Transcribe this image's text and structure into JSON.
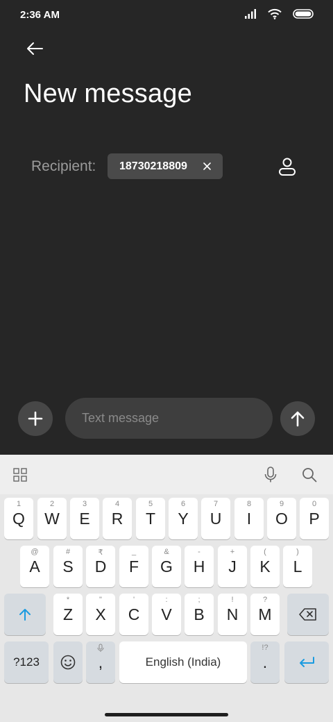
{
  "status": {
    "time": "2:36 AM"
  },
  "header": {
    "title": "New message"
  },
  "recipient": {
    "label": "Recipient:",
    "chip_value": "18730218809"
  },
  "compose": {
    "placeholder": "Text message"
  },
  "keyboard": {
    "row1": [
      {
        "letter": "Q",
        "hint": "1"
      },
      {
        "letter": "W",
        "hint": "2"
      },
      {
        "letter": "E",
        "hint": "3"
      },
      {
        "letter": "R",
        "hint": "4"
      },
      {
        "letter": "T",
        "hint": "5"
      },
      {
        "letter": "Y",
        "hint": "6"
      },
      {
        "letter": "U",
        "hint": "7"
      },
      {
        "letter": "I",
        "hint": "8"
      },
      {
        "letter": "O",
        "hint": "9"
      },
      {
        "letter": "P",
        "hint": "0"
      }
    ],
    "row2": [
      {
        "letter": "A",
        "hint": "@"
      },
      {
        "letter": "S",
        "hint": "#"
      },
      {
        "letter": "D",
        "hint": "₹"
      },
      {
        "letter": "F",
        "hint": "_"
      },
      {
        "letter": "G",
        "hint": "&"
      },
      {
        "letter": "H",
        "hint": "-"
      },
      {
        "letter": "J",
        "hint": "+"
      },
      {
        "letter": "K",
        "hint": "("
      },
      {
        "letter": "L",
        "hint": ")"
      }
    ],
    "row3": [
      {
        "letter": "Z",
        "hint": "*"
      },
      {
        "letter": "X",
        "hint": "\""
      },
      {
        "letter": "C",
        "hint": "'"
      },
      {
        "letter": "V",
        "hint": ":"
      },
      {
        "letter": "B",
        "hint": ";"
      },
      {
        "letter": "N",
        "hint": "!"
      },
      {
        "letter": "M",
        "hint": "?"
      }
    ],
    "symbols_label": "?123",
    "comma": ",",
    "space_label": "English (India)",
    "period": ".",
    "period_hint": "!?"
  },
  "colors": {
    "accent": "#1a9be0",
    "background": "#262626",
    "keyboard_bg": "#e7e7e7"
  }
}
